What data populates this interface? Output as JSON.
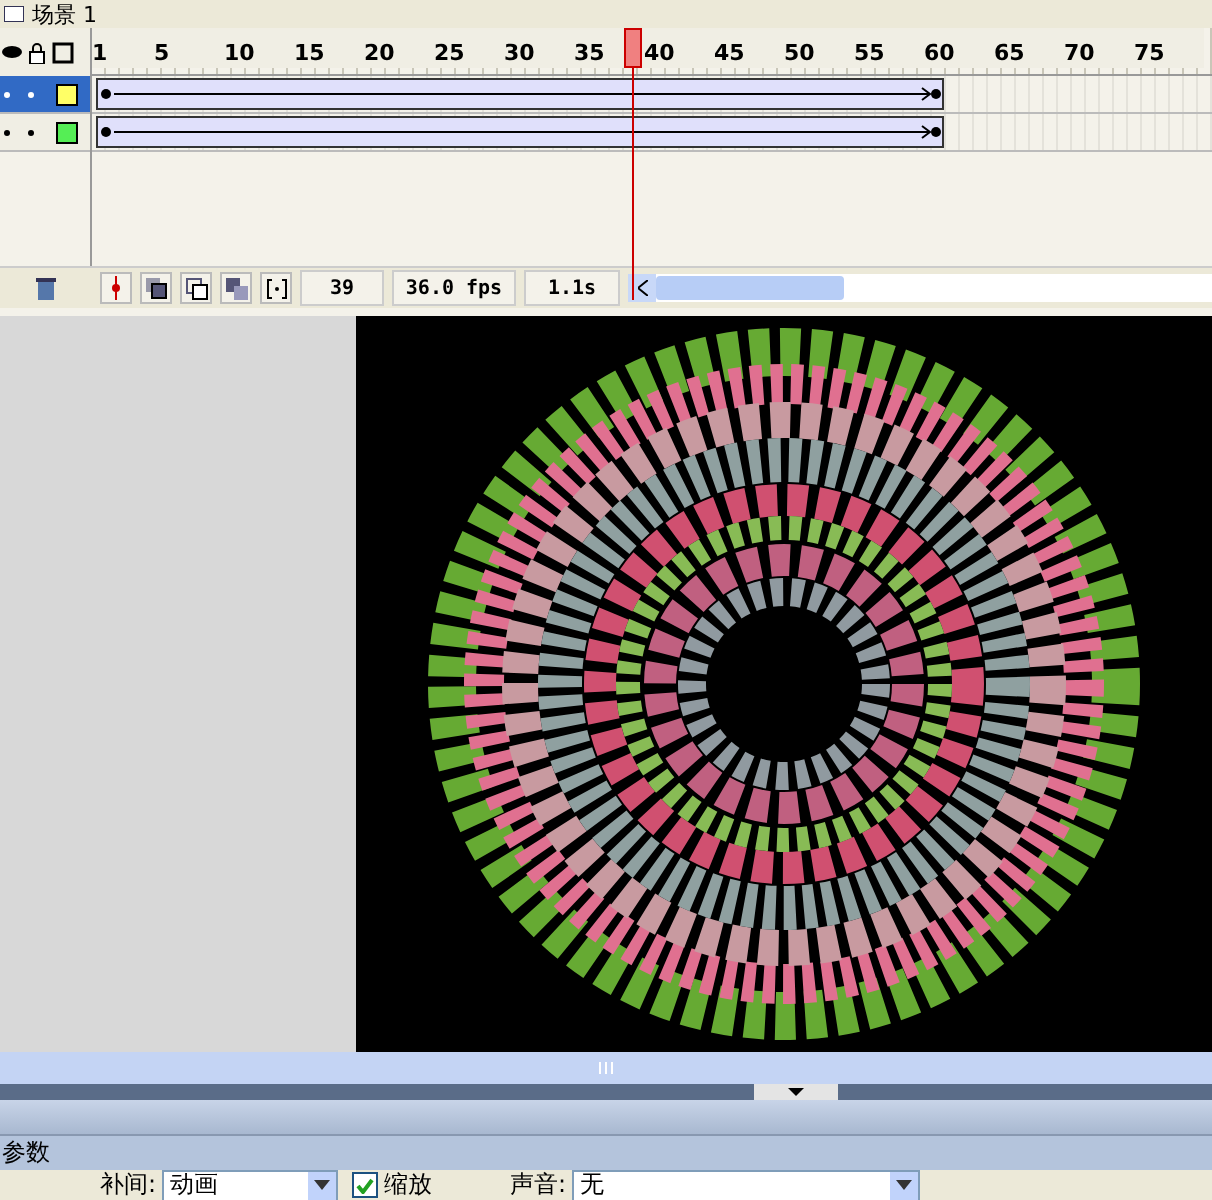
{
  "scene": {
    "title": "场景 1"
  },
  "ruler": {
    "ticks": [
      "1",
      "5",
      "10",
      "15",
      "20",
      "25",
      "30",
      "35",
      "40",
      "45",
      "50",
      "55",
      "60",
      "65",
      "70",
      "75"
    ]
  },
  "layers": [
    {
      "selected": true,
      "color": "#ffff66"
    },
    {
      "selected": false,
      "color": "#55ee55"
    }
  ],
  "timeline_status": {
    "frame": "39",
    "fps": "36.0 fps",
    "time": "1.1s"
  },
  "properties": {
    "title": "参数",
    "tween_label": "补间:",
    "tween_value": "动画",
    "scale": {
      "label": "缩放",
      "checked": true
    },
    "sound_label": "声音:",
    "sound_value": "无"
  }
}
